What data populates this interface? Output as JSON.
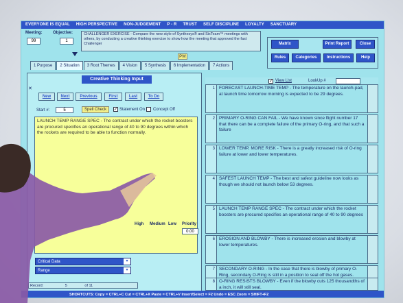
{
  "topbar": {
    "items": [
      "EVERYONE IS EQUAL",
      "HIGH PERSPECTIVE",
      "NON-JUDGEMENT",
      "P - R",
      "TRUST",
      "SELF DISCIPLINE",
      "LOYALTY",
      "SANCTUARY"
    ]
  },
  "header": {
    "meeting_label": "Meeting:",
    "meeting_value": "99",
    "objective_label": "Objective:",
    "objective_value": "1",
    "objective_text": "CHALLENGER EXERCISE - Compare the new style of Synthesys® and SixTeam™ meetings with others, by conducting a creative thinking exercise to show how the meeting that approved the fast Challenger",
    "yellow_tag": "PW"
  },
  "tabs": [
    "1 Purpose",
    "2 Situation",
    "3 Root Themes",
    "4 Vision",
    "5 Synthesis",
    "6 Implementation",
    "7 Actions"
  ],
  "right_buttons": {
    "matrix": "Matrix",
    "print_report": "Print Report",
    "close": "Close",
    "rules": "Rules",
    "categories": "Categories",
    "instructions": "Instructions",
    "help": "Help"
  },
  "creative": {
    "title": "Creative Thinking Input",
    "nav": [
      "New",
      "Next",
      "Previous",
      "First",
      "Last",
      "To Do"
    ],
    "start_label": "Start #:",
    "start_value": "5",
    "spell_check": "Spell Check",
    "statement_on": "Statement On",
    "concept_off": "Concept Off",
    "text": "LAUNCH TEMP RANGE SPEC - The contract under which the rocket boosters are procured specifies an operational range of 40 to 90 degrees within which the rockets are required to be able to function normally.",
    "priority_labels": [
      "High",
      "Medium",
      "Low",
      "Priority"
    ],
    "priority_value": "0.00",
    "dropdowns": [
      "Critical Data",
      "Range"
    ],
    "record_label": "Record:",
    "record_value": "5",
    "record_of": "of 11"
  },
  "list": {
    "view_list": "View List",
    "lookup_label": "LookUp #",
    "items": [
      {
        "num": "1",
        "text": "FORECAST LAUNCH-TIME TEMP - The temperature on the launch-pad, at launch time tomorrow morning is expected to be 29 degrees."
      },
      {
        "num": "2",
        "text": "PRIMARY O-RING CAN FAIL - We have known since flight number 17 that there can be a complete failure of the primary O-ring, and that such a failure"
      },
      {
        "num": "3",
        "text": "LOWER TEMP, MORE RISK - There is a greatly increased risk of O-ring failure at lower and lower temperatures."
      },
      {
        "num": "4",
        "text": "SAFEST LAUNCH TEMP - The best and safest guideline now looks as though we should not launch below 53 degrees."
      },
      {
        "num": "5",
        "text": "LAUNCH TEMP RANGE SPEC - The contract under which the rocket boosters are procured specifies an operational range of 40 to 90 degrees"
      },
      {
        "num": "6",
        "text": "EROSION AND BLOWBY - There is increased erosion and blowby at lower temperatures."
      },
      {
        "num": "7",
        "text": "SECONDARY O-RING - In the case that there is blowby of primary O-Ring, secondary O-Ring is still in a position to seal off the hot gases."
      },
      {
        "num": "8",
        "text": "O-RING RESISTS BLOWBY - Even if the blowby cuts 125 thousandths of a inch, it will still seal."
      }
    ]
  },
  "bottombar": {
    "text": "SHORTCUTS: Copy = CTRL+C    Cut = CTRL+X    Paste = CTRL+V    Insert/Select = F2    Undo = ESC    Zoom = SHIFT+F2"
  }
}
